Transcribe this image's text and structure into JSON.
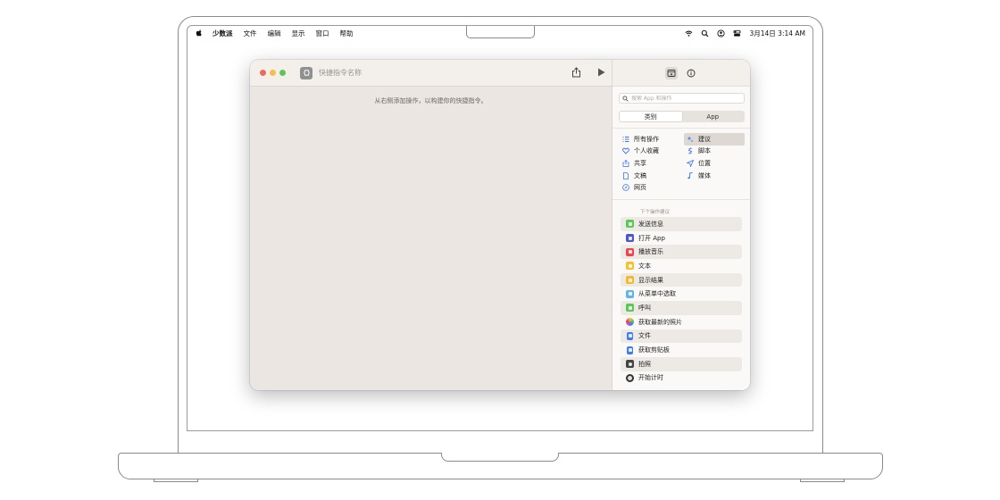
{
  "menubar": {
    "app_name": "少数派",
    "menus": [
      "文件",
      "编辑",
      "显示",
      "窗口",
      "帮助"
    ],
    "clock": "3月14日 3:14 AM"
  },
  "window": {
    "shortcut_name_placeholder": "快捷指令名称",
    "canvas_hint": "从右侧添加操作，以构建你的快捷指令。"
  },
  "sidebar": {
    "search_placeholder": "搜索 App 和操作",
    "segments": [
      "类别",
      "App"
    ],
    "categories": [
      {
        "label": "所有操作",
        "icon": "list-icon",
        "color": "#3478f6"
      },
      {
        "label": "建议",
        "icon": "sparkle-icon",
        "color": "#3478f6"
      },
      {
        "label": "个人收藏",
        "icon": "heart-icon",
        "color": "#3478f6"
      },
      {
        "label": "脚本",
        "icon": "script-icon",
        "color": "#3478f6"
      },
      {
        "label": "共享",
        "icon": "share-icon",
        "color": "#3478f6"
      },
      {
        "label": "位置",
        "icon": "location-icon",
        "color": "#3478f6"
      },
      {
        "label": "文稿",
        "icon": "document-icon",
        "color": "#3478f6"
      },
      {
        "label": "媒体",
        "icon": "music-note-icon",
        "color": "#3478f6"
      },
      {
        "label": "网页",
        "icon": "compass-icon",
        "color": "#3478f6"
      }
    ],
    "next_title": "下个操作建议",
    "next_actions": [
      {
        "label": "发送信息",
        "color": "#5bc853"
      },
      {
        "label": "打开 App",
        "color": "#4d55d6"
      },
      {
        "label": "播放音乐",
        "color": "#f2414f"
      },
      {
        "label": "文本",
        "color": "#f5c22d"
      },
      {
        "label": "显示结果",
        "color": "#f5b92d"
      },
      {
        "label": "从菜单中选取",
        "color": "#5fb3ef"
      },
      {
        "label": "呼叫",
        "color": "#5bc853"
      },
      {
        "label": "获取最新的照片",
        "color": "#e88a3a"
      },
      {
        "label": "文件",
        "color": "#3e7cf0"
      },
      {
        "label": "获取剪贴板",
        "color": "#3e7cf0"
      },
      {
        "label": "拍照",
        "color": "#444444"
      },
      {
        "label": "开始计时",
        "color": "#333333"
      }
    ]
  }
}
